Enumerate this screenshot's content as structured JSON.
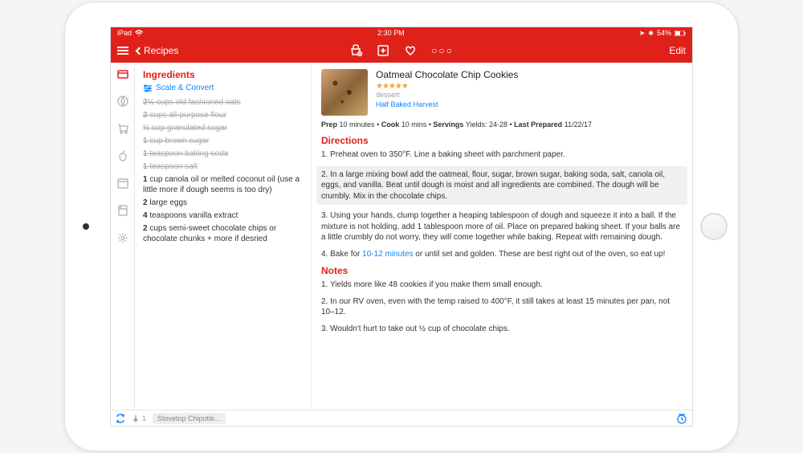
{
  "status": {
    "carrier": "iPad",
    "time": "2:30 PM",
    "battery": "54%"
  },
  "nav": {
    "back_label": "Recipes",
    "edit_label": "Edit"
  },
  "ingredients": {
    "title": "Ingredients",
    "scale_convert": "Scale & Convert",
    "items": [
      {
        "qty": "2½",
        "text": "cups old fashioned oats",
        "struck": true
      },
      {
        "qty": "2",
        "text": "cups all-purpose flour",
        "struck": true
      },
      {
        "qty": "½",
        "text": "cup granulated sugar",
        "struck": true
      },
      {
        "qty": "1",
        "text": "cup brown sugar",
        "struck": true
      },
      {
        "qty": "1",
        "text": "teaspoon baking soda",
        "struck": true
      },
      {
        "qty": "1",
        "text": "teaspoon salt",
        "struck": true
      },
      {
        "qty": "1",
        "text": "cup canola oil or melted coconut oil (use a little more if dough seems is too dry)",
        "struck": false
      },
      {
        "qty": "2",
        "text": "large eggs",
        "struck": false
      },
      {
        "qty": "4",
        "text": "teaspoons vanilla extract",
        "struck": false
      },
      {
        "qty": "2",
        "text": "cups semi-sweet chocolate chips or chocolate chunks + more if desried",
        "struck": false
      }
    ]
  },
  "recipe": {
    "title": "Oatmeal Chocolate Chip Cookies",
    "stars": "★★★★★",
    "category": "dessert",
    "source": "Half Baked Harvest",
    "meta": {
      "prep_lbl": "Prep",
      "prep": "10 minutes",
      "cook_lbl": "Cook",
      "cook": "10 mins",
      "servings_lbl": "Servings",
      "servings": "Yields: 24-28",
      "last_lbl": "Last Prepared",
      "last": "11/22/17"
    },
    "directions_title": "Directions",
    "directions": [
      {
        "text": "1. Preheat oven to 350°F. Line a baking sheet with parchment paper.",
        "hl": false
      },
      {
        "text": "2. In a large mixing bowl add the oatmeal, flour, sugar, brown sugar, baking soda, salt, canola oil, eggs, and vanilla. Beat until dough is moist and all ingredients are combined. The dough will be crumbly. Mix in the chocolate chips.",
        "hl": true
      },
      {
        "text": "3. Using your hands, clump together a heaping tablespoon of dough and squeeze it into a ball. If the mixture is not holding, add 1 tablespoon more of oil. Place on prepared baking sheet. If your balls are a little crumbly do not worry, they will come together while baking. Repeat with remaining dough.",
        "hl": false
      },
      {
        "text_pre": "4. Bake for ",
        "link": "10-12 minutes",
        "text_post": " or until set and golden. These are best right out of the oven, so eat up!",
        "hl": false
      }
    ],
    "notes_title": "Notes",
    "notes": [
      "1. Yields more like 48 cookies if you make them small enough.",
      "2. In our RV oven, even with the temp raised to 400°F, it still takes at least 15 minutes per pan, not 10–12.",
      "3. Wouldn't hurt to take out ½ cup of chocolate chips."
    ]
  },
  "bottom": {
    "pin_count": "1",
    "chip": "Stovetop Chipotle..."
  }
}
